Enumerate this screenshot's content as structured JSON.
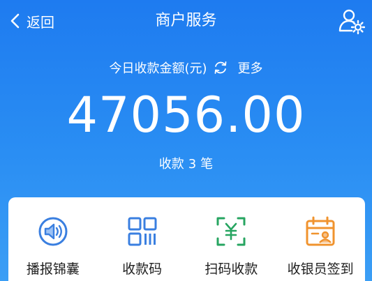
{
  "nav": {
    "back_label": "返回",
    "title": "商户服务"
  },
  "summary": {
    "label": "今日收款金额(元)",
    "more_label": "更多",
    "amount": "47056.00",
    "count_prefix": "收款",
    "count_value": "3",
    "count_suffix": "笔"
  },
  "services": [
    {
      "label": "播报锦囊",
      "icon": "speaker-icon",
      "color": "#3a7fe0"
    },
    {
      "label": "收款码",
      "icon": "qr-code-icon",
      "color": "#3a7fe0"
    },
    {
      "label": "扫码收款",
      "icon": "scan-yuan-icon",
      "color": "#27a561"
    },
    {
      "label": "收银员签到",
      "icon": "calendar-user-icon",
      "color": "#f0932e"
    }
  ],
  "colors": {
    "header_start": "#1e7bf0",
    "header_end": "#3b9ef5"
  }
}
